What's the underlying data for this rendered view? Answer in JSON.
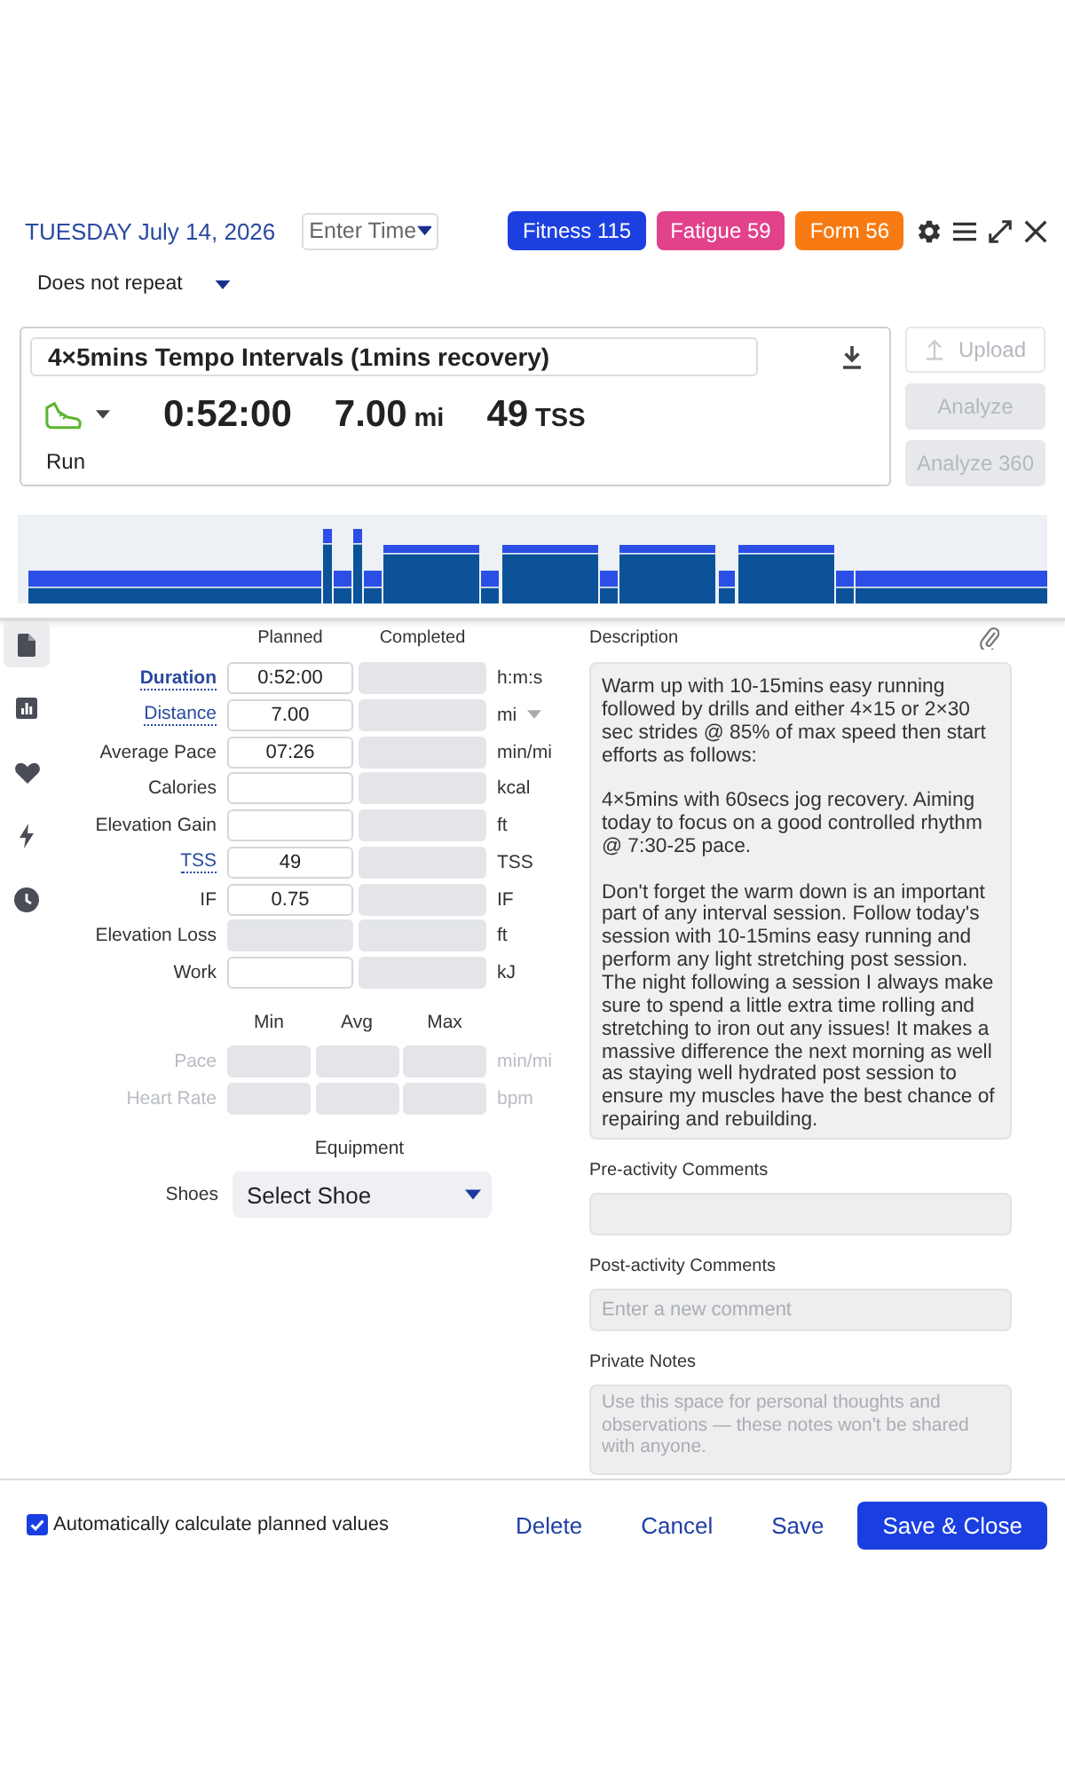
{
  "header": {
    "date": "TUESDAY July 14, 2026",
    "time_field": {
      "placeholder": "Enter Time"
    },
    "badges": [
      {
        "label": "Fitness 115",
        "color": "#1c3fe0"
      },
      {
        "label": "Fatigue 59",
        "color": "#e2418c"
      },
      {
        "label": "Form 56",
        "color": "#f77b12"
      }
    ]
  },
  "repeat": {
    "value": "Does not repeat"
  },
  "workout": {
    "title": "4×5mins Tempo Intervals (1mins recovery)",
    "sport": "Run",
    "duration": "0:52:00",
    "distance": "7.00",
    "distance_unit": "mi",
    "tss": "49",
    "tss_unit": "TSS"
  },
  "actions": [
    {
      "label": "Upload",
      "kind": "outline",
      "disabled": true
    },
    {
      "label": "Analyze",
      "kind": "filled",
      "disabled": true
    },
    {
      "label": "Analyze 360",
      "kind": "filled",
      "disabled": true
    }
  ],
  "side_tabs": [
    {
      "selected": true
    },
    {
      "selected": false
    },
    {
      "selected": false
    },
    {
      "selected": false
    },
    {
      "selected": false
    }
  ],
  "metrics": {
    "columns": [
      "Planned",
      "Completed"
    ],
    "rows": [
      {
        "label": "Duration",
        "link": true,
        "bold": true,
        "planned": {
          "value": "0:52:00",
          "disabled": false
        },
        "completed": {
          "disabled": true
        },
        "unit": "h:m:s",
        "unit_dropdown": false
      },
      {
        "label": "Distance",
        "link": true,
        "bold": false,
        "planned": {
          "value": "7.00",
          "disabled": false
        },
        "completed": {
          "disabled": true
        },
        "unit": "mi",
        "unit_dropdown": true
      },
      {
        "label": "Average Pace",
        "link": false,
        "bold": false,
        "planned": {
          "value": "07:26",
          "disabled": false
        },
        "completed": {
          "disabled": true
        },
        "unit": "min/mi",
        "unit_dropdown": false
      },
      {
        "label": "Calories",
        "link": false,
        "bold": false,
        "planned": {
          "disabled": false
        },
        "completed": {
          "disabled": true
        },
        "unit": "kcal",
        "unit_dropdown": false
      },
      {
        "label": "Elevation Gain",
        "link": false,
        "bold": false,
        "planned": {
          "disabled": false
        },
        "completed": {
          "disabled": true
        },
        "unit": "ft",
        "unit_dropdown": false
      },
      {
        "label": "TSS",
        "link": true,
        "bold": false,
        "planned": {
          "value": "49",
          "disabled": false
        },
        "completed": {
          "disabled": true
        },
        "unit": "TSS",
        "unit_dropdown": false
      },
      {
        "label": "IF",
        "link": false,
        "bold": false,
        "planned": {
          "value": "0.75",
          "disabled": false
        },
        "completed": {
          "disabled": true
        },
        "unit": "IF",
        "unit_dropdown": false
      },
      {
        "label": "Elevation Loss",
        "link": false,
        "bold": false,
        "planned": {
          "disabled": true
        },
        "completed": {
          "disabled": true
        },
        "unit": "ft",
        "unit_dropdown": false
      },
      {
        "label": "Work",
        "link": false,
        "bold": false,
        "planned": {
          "disabled": false
        },
        "completed": {
          "disabled": true
        },
        "unit": "kJ",
        "unit_dropdown": false
      }
    ]
  },
  "ranges": {
    "columns": [
      "Min",
      "Avg",
      "Max"
    ],
    "rows": [
      {
        "label": "Pace",
        "unit": "min/mi",
        "disabled": true
      },
      {
        "label": "Heart Rate",
        "unit": "bpm",
        "disabled": true
      }
    ]
  },
  "equipment": {
    "title": "Equipment",
    "shoes": {
      "label": "Shoes",
      "placeholder": "Select Shoe"
    }
  },
  "description": {
    "label": "Description",
    "value": "Warm up with 10-15mins easy running followed by drills and either 4×15 or 2×30 sec strides @ 85% of max speed then start efforts as follows:\n\n4×5mins with 60secs jog recovery. Aiming today to focus on a good controlled rhythm @ 7:30-25 pace.\n\nDon't forget the warm down is an important part of any interval session. Follow today's session with 10-15mins easy running and perform any light stretching post session. The night following a session I always make sure to spend a little extra time rolling and stretching to iron out any issues! It makes a massive difference the next morning as well as staying well hydrated post session to ensure my muscles have the best chance of repairing and rebuilding."
  },
  "pre_activity_comments": {
    "label": "Pre-activity Comments"
  },
  "post_activity_comments": {
    "label": "Post-activity Comments",
    "placeholder": "Enter a new comment"
  },
  "private_notes": {
    "label": "Private Notes",
    "placeholder": "Use this space for personal thoughts and observations — these notes won't be shared with anyone."
  },
  "footer": {
    "auto_calculate": {
      "label": "Automatically calculate planned values",
      "checked": true
    },
    "buttons": [
      {
        "label": "Delete",
        "kind": "link"
      },
      {
        "label": "Cancel",
        "kind": "link"
      },
      {
        "label": "Save",
        "kind": "link"
      },
      {
        "label": "Save & Close",
        "kind": "primary"
      }
    ]
  }
}
